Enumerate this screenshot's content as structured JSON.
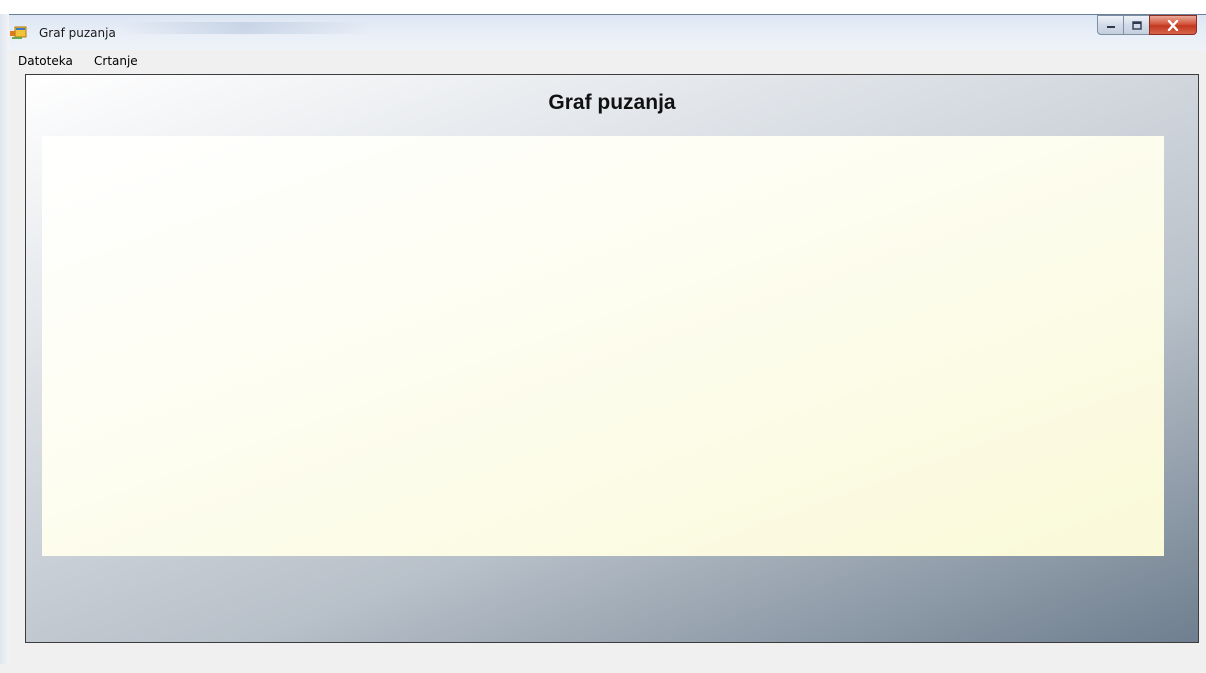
{
  "window": {
    "title": "Graf puzanja",
    "icon": "app-window-icon"
  },
  "title_controls": {
    "minimize_icon": "minimize-icon",
    "maximize_icon": "maximize-icon",
    "close_icon": "close-icon"
  },
  "menu": {
    "items": [
      {
        "label": "Datoteka"
      },
      {
        "label": "Crtanje"
      }
    ]
  },
  "panel": {
    "title": "Graf puzanja"
  },
  "colors": {
    "plot_background": "#fdfdf0",
    "panel_gradient_dark": "#6f7f8f",
    "close_button": "#c3381f"
  }
}
